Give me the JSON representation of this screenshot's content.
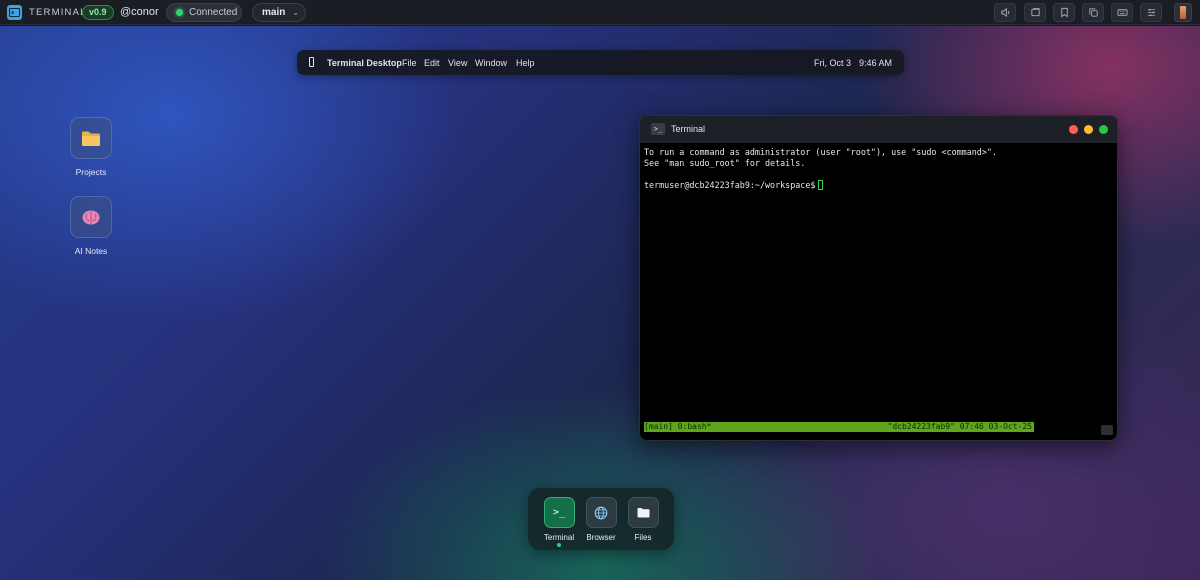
{
  "topbar": {
    "brand": "TERMINAL",
    "version": "v0.9",
    "user": "@conor",
    "connection": "Connected",
    "branch": "main",
    "buttons": [
      "volume-icon",
      "window-icon",
      "bookmark-icon",
      "copy-icon",
      "keyboard-icon",
      "settings-sliders-icon"
    ]
  },
  "menubar": {
    "app_name": "Terminal Desktop",
    "items": [
      "File",
      "Edit",
      "View",
      "Window",
      "Help"
    ],
    "date": "Fri, Oct 3",
    "time": "9:46 AM"
  },
  "desktop_icons": [
    {
      "label": "Projects",
      "icon": "folder-icon"
    },
    {
      "label": "AI Notes",
      "icon": "brain-icon"
    }
  ],
  "terminal": {
    "title": "Terminal",
    "lines": [
      "To run a command as administrator (user \"root\"), use \"sudo <command>\".",
      "See \"man sudo_root\" for details.",
      "",
      "termuser@dcb24223fab9:~/workspace$"
    ],
    "status_left": "[main] 0:bash*",
    "status_right": "\"dcb24223fab9\" 07:46 03-Oct-25",
    "colors": {
      "close": "#ff5f57",
      "minimize": "#febc2e",
      "maximize": "#28c840",
      "status": "#5fa51d"
    }
  },
  "dock": {
    "items": [
      {
        "label": "Terminal",
        "icon": "terminal-prompt-icon",
        "glyph": ">_"
      },
      {
        "label": "Browser",
        "icon": "globe-icon"
      },
      {
        "label": "Files",
        "icon": "folder-icon"
      }
    ]
  }
}
